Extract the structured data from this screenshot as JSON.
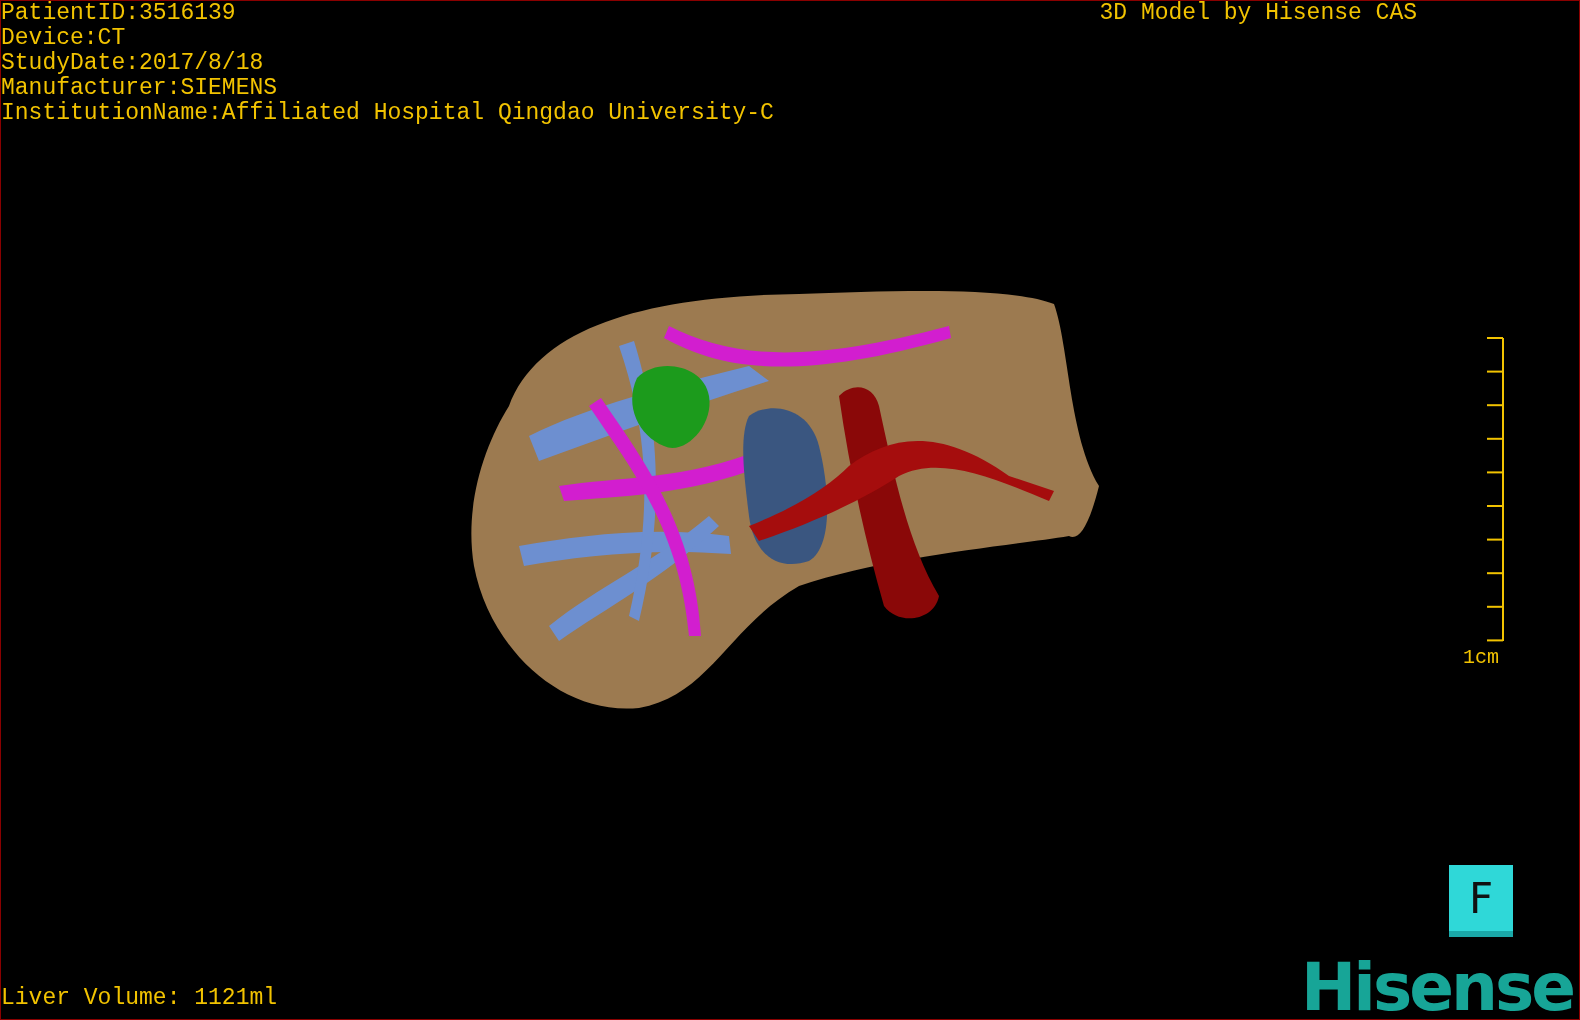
{
  "info_lines": [
    "PatientID:3516139",
    "Device:CT",
    "StudyDate:2017/8/18",
    "Manufacturer:SIEMENS",
    "InstitutionName:Affiliated Hospital Qingdao University-C"
  ],
  "credit": "3D Model by Hisense CAS",
  "scale_bar": {
    "label": "1cm"
  },
  "orientation_marker": {
    "label": "F"
  },
  "volume": "Liver Volume: 1121ml",
  "logo": "Hisense"
}
